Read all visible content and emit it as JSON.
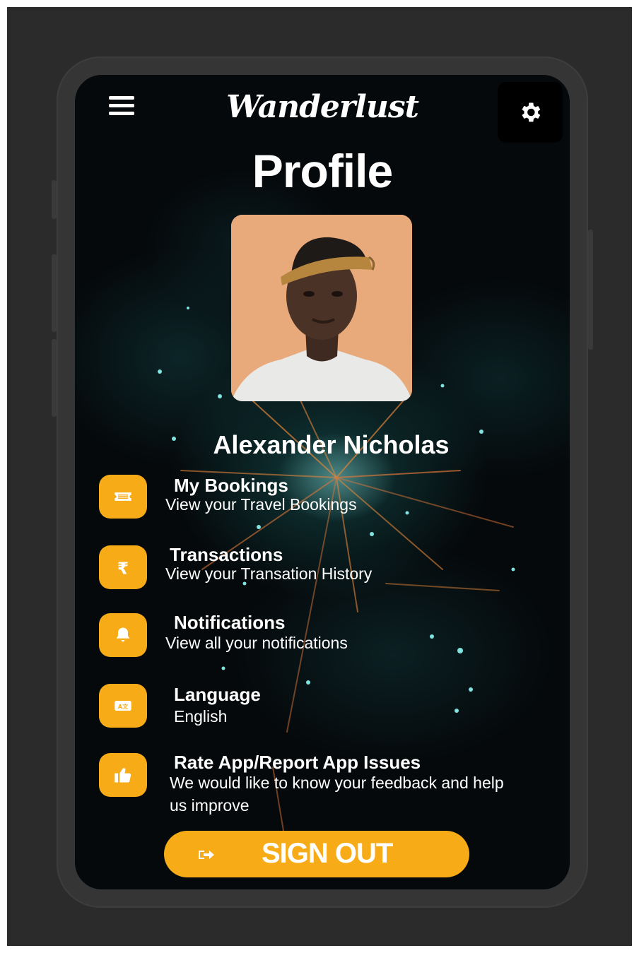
{
  "app": {
    "brand": "Wanderlust",
    "page_title": "Profile"
  },
  "user": {
    "name": "Alexander Nicholas"
  },
  "menu": [
    {
      "title": "My Bookings",
      "subtitle": "View your Travel Bookings",
      "icon": "ticket-icon"
    },
    {
      "title": "Transactions",
      "subtitle": "View your Transation History",
      "icon": "rupee-icon"
    },
    {
      "title": "Notifications",
      "subtitle": "View all your notifications",
      "icon": "bell-icon"
    },
    {
      "title": "Language",
      "subtitle": "English",
      "icon": "language-icon"
    },
    {
      "title": "Rate App/Report App Issues",
      "subtitle": "We would like to know your feedback and help us improve",
      "icon": "thumbs-up-icon"
    }
  ],
  "signout": {
    "label": "SIGN OUT",
    "icon": "sign-out-icon"
  },
  "header": {
    "menu_icon": "hamburger-menu-icon",
    "settings_icon": "gear-icon"
  },
  "colors": {
    "accent": "#f7ab17",
    "background": "#05090b",
    "text": "#ffffff"
  }
}
